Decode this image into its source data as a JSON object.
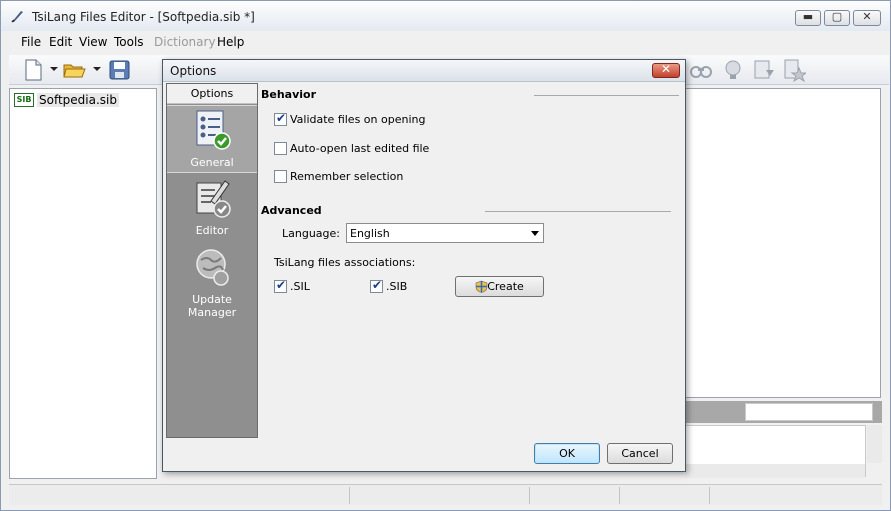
{
  "window": {
    "title": "TsiLang Files Editor - [Softpedia.sib *]",
    "min_glyph": "▬",
    "max_glyph": "▢",
    "close_glyph": "✕"
  },
  "menu": [
    {
      "label": "File",
      "enabled": true
    },
    {
      "label": "Edit",
      "enabled": true
    },
    {
      "label": "View",
      "enabled": true
    },
    {
      "label": "Tools",
      "enabled": true
    },
    {
      "label": "Dictionary",
      "enabled": false
    },
    {
      "label": "Help",
      "enabled": true
    }
  ],
  "toolbar": {
    "icons": [
      "new-file-icon",
      "open-folder-icon",
      "save-disk-icon",
      "find-icon",
      "hint-icon",
      "import-icon",
      "favorite-icon"
    ]
  },
  "tree": {
    "items": [
      {
        "badge": "SIB",
        "label": "Softpedia.sib"
      }
    ]
  },
  "dialog": {
    "title": "Options",
    "close_glyph": "✕",
    "sidebar_header": "Options",
    "sidebar_items": [
      {
        "label": "General",
        "active": true,
        "icon": "general-checklist-icon"
      },
      {
        "label": "Editor",
        "active": false,
        "icon": "editor-pencil-icon"
      },
      {
        "label": "Update Manager",
        "active": false,
        "icon": "update-globe-icon"
      }
    ],
    "behavior": {
      "heading": "Behavior",
      "options": [
        {
          "label": "Validate files on opening",
          "checked": true
        },
        {
          "label": "Auto-open last edited file",
          "checked": false
        },
        {
          "label": "Remember selection",
          "checked": false
        }
      ]
    },
    "advanced": {
      "heading": "Advanced",
      "language_label": "Language:",
      "language_value": "English",
      "associations_label": "TsiLang files associations:",
      "assoc": [
        {
          "label": ".SIL",
          "checked": true
        },
        {
          "label": ".SIB",
          "checked": true
        }
      ],
      "create_label": "Create"
    },
    "ok_label": "OK",
    "cancel_label": "Cancel"
  },
  "check_glyph": "✔",
  "colors": {
    "accent_blue": "#3c7fb1",
    "sidebar_gray": "#8f8f8f",
    "close_red": "#c3412a"
  }
}
